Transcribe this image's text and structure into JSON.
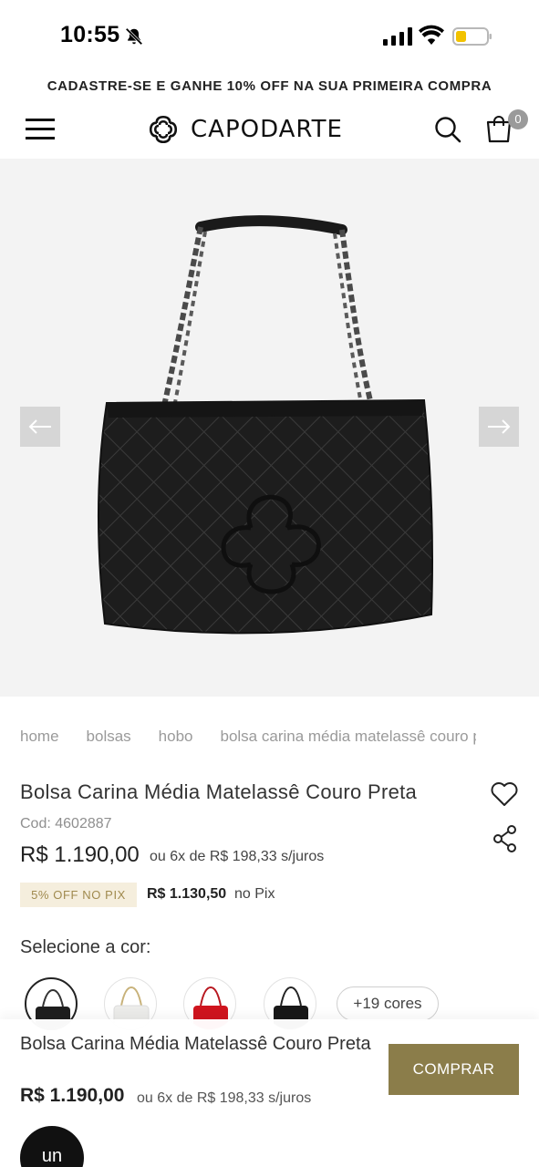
{
  "status_bar": {
    "time": "10:55",
    "icons": [
      "bell-off-icon",
      "signal-icon",
      "wifi-icon",
      "battery-icon"
    ]
  },
  "promo": {
    "text": "CADASTRE-SE E GANHE 10% OFF NA SUA PRIMEIRA COMPRA"
  },
  "header": {
    "logo_text": "CAPODARTE",
    "cart_count": "0",
    "icons": [
      "menu-icon",
      "search-icon",
      "shopping-bag-icon"
    ]
  },
  "gallery": {
    "icons": [
      "arrow-left-icon",
      "arrow-right-icon"
    ]
  },
  "breadcrumb": [
    "home",
    "bolsas",
    "hobo",
    "bolsa carina média matelassê couro preta"
  ],
  "product": {
    "title": "Bolsa Carina Média Matelassê Couro Preta",
    "code": "Cod: 4602887",
    "price": "R$ 1.190,00",
    "installments": "ou 6x de R$ 198,33 s/juros",
    "pix_badge": "5% OFF NO PIX",
    "pix_price": "R$ 1.130,50",
    "pix_suffix": "no Pix"
  },
  "colors": {
    "label": "Selecione a cor:",
    "more": "+19 cores",
    "swatches": [
      "black",
      "white",
      "red",
      "black"
    ]
  },
  "sticky": {
    "title": "Bolsa Carina Média Matelassê Couro Preta",
    "price": "R$ 1.190,00",
    "installments": "ou 6x de R$ 198,33 s/juros",
    "buy_label": "COMPRAR",
    "chat_label": "un"
  },
  "theme": {
    "accent": "#8b7d4a",
    "pix_badge_bg": "#f5eedd",
    "gallery_bg": "#f3f3f3"
  }
}
